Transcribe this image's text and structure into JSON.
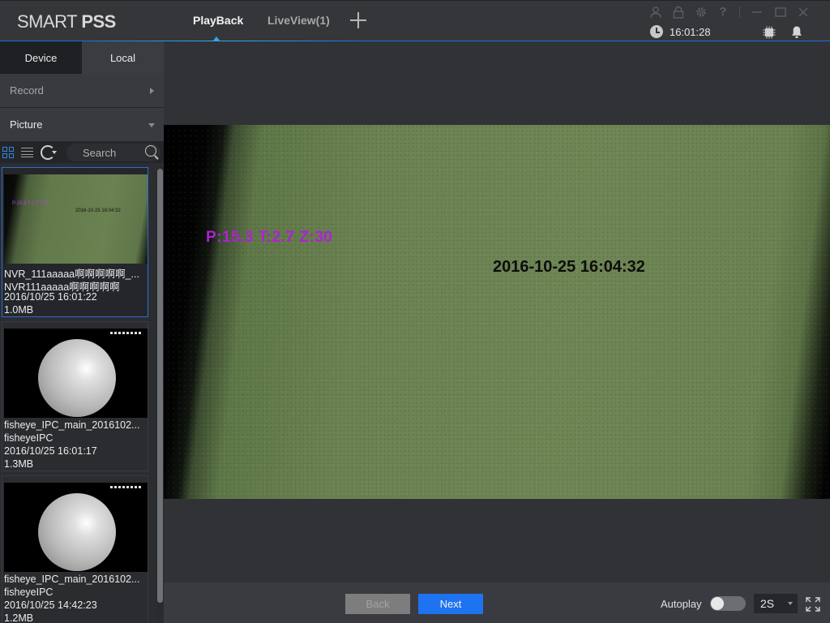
{
  "app": {
    "logo_light": "SMART ",
    "logo_bold": "PSS"
  },
  "tabs": [
    {
      "label": "PlayBack",
      "active": true
    },
    {
      "label": "LiveView(1)",
      "active": false
    }
  ],
  "window_icons": [
    "user-icon",
    "lock-icon",
    "gear-icon",
    "help-icon",
    "minimize-icon",
    "maximize-icon",
    "close-icon"
  ],
  "status": {
    "time": "16:01:28"
  },
  "left_panel": {
    "tabs": [
      {
        "label": "Device",
        "active": true
      },
      {
        "label": "Local",
        "active": false
      }
    ],
    "record_label": "Record",
    "picture_label": "Picture",
    "search_placeholder": "Search"
  },
  "files": [
    {
      "name": "NVR_111aaaaa啊啊啊啊啊_...",
      "device": "NVR111aaaaa啊啊啊啊啊",
      "time": "2016/10/25 16:01:22",
      "size": "1.0MB",
      "selected": true,
      "thumb_type": "green",
      "thumb_osd_ptz": "P:15.3 T:2.7 Z:30",
      "thumb_osd_time": "2016-10-25 16:04:32"
    },
    {
      "name": "fisheye_IPC_main_2016102...",
      "device": "fisheyeIPC",
      "time": "2016/10/25 16:01:17",
      "size": "1.3MB",
      "selected": false,
      "thumb_type": "fisheye"
    },
    {
      "name": "fisheye_IPC_main_2016102...",
      "device": "fisheyeIPC",
      "time": "2016/10/25 14:42:23",
      "size": "1.2MB",
      "selected": false,
      "thumb_type": "fisheye"
    }
  ],
  "viewer": {
    "osd_ptz": "P:15.3 T:2.7 Z:30",
    "osd_timestamp": "2016-10-25 16:04:32"
  },
  "bottom": {
    "back_label": "Back",
    "next_label": "Next",
    "autoplay_label": "Autoplay",
    "autoplay_on": false,
    "interval_value": "2S"
  },
  "colors": {
    "accent": "#1e73f0",
    "tab_underline": "#1d6fd6",
    "osd_purple": "#b21fd8"
  }
}
